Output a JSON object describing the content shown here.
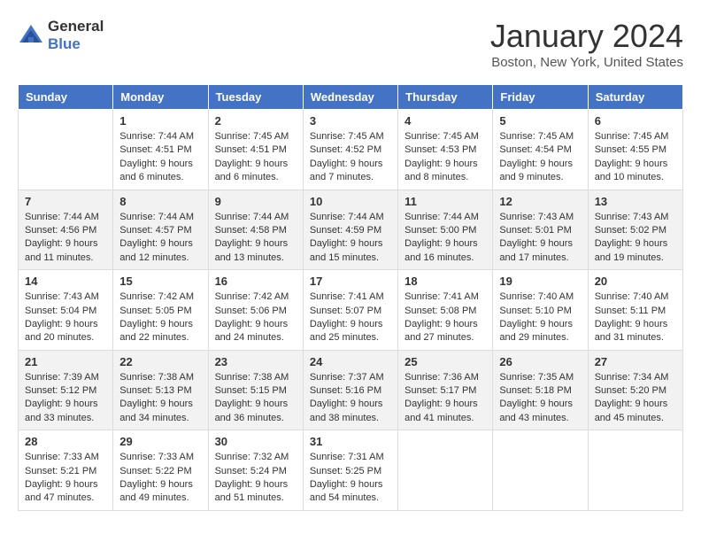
{
  "header": {
    "logo_general": "General",
    "logo_blue": "Blue",
    "month": "January 2024",
    "location": "Boston, New York, United States"
  },
  "days": [
    "Sunday",
    "Monday",
    "Tuesday",
    "Wednesday",
    "Thursday",
    "Friday",
    "Saturday"
  ],
  "weeks": [
    [
      {
        "day": "",
        "content": ""
      },
      {
        "day": "1",
        "content": "Sunrise: 7:44 AM\nSunset: 4:51 PM\nDaylight: 9 hours and 6 minutes."
      },
      {
        "day": "2",
        "content": "Sunrise: 7:45 AM\nSunset: 4:51 PM\nDaylight: 9 hours and 6 minutes."
      },
      {
        "day": "3",
        "content": "Sunrise: 7:45 AM\nSunset: 4:52 PM\nDaylight: 9 hours and 7 minutes."
      },
      {
        "day": "4",
        "content": "Sunrise: 7:45 AM\nSunset: 4:53 PM\nDaylight: 9 hours and 8 minutes."
      },
      {
        "day": "5",
        "content": "Sunrise: 7:45 AM\nSunset: 4:54 PM\nDaylight: 9 hours and 9 minutes."
      },
      {
        "day": "6",
        "content": "Sunrise: 7:45 AM\nSunset: 4:55 PM\nDaylight: 9 hours and 10 minutes."
      }
    ],
    [
      {
        "day": "7",
        "content": "Sunrise: 7:44 AM\nSunset: 4:56 PM\nDaylight: 9 hours and 11 minutes."
      },
      {
        "day": "8",
        "content": "Sunrise: 7:44 AM\nSunset: 4:57 PM\nDaylight: 9 hours and 12 minutes."
      },
      {
        "day": "9",
        "content": "Sunrise: 7:44 AM\nSunset: 4:58 PM\nDaylight: 9 hours and 13 minutes."
      },
      {
        "day": "10",
        "content": "Sunrise: 7:44 AM\nSunset: 4:59 PM\nDaylight: 9 hours and 15 minutes."
      },
      {
        "day": "11",
        "content": "Sunrise: 7:44 AM\nSunset: 5:00 PM\nDaylight: 9 hours and 16 minutes."
      },
      {
        "day": "12",
        "content": "Sunrise: 7:43 AM\nSunset: 5:01 PM\nDaylight: 9 hours and 17 minutes."
      },
      {
        "day": "13",
        "content": "Sunrise: 7:43 AM\nSunset: 5:02 PM\nDaylight: 9 hours and 19 minutes."
      }
    ],
    [
      {
        "day": "14",
        "content": "Sunrise: 7:43 AM\nSunset: 5:04 PM\nDaylight: 9 hours and 20 minutes."
      },
      {
        "day": "15",
        "content": "Sunrise: 7:42 AM\nSunset: 5:05 PM\nDaylight: 9 hours and 22 minutes."
      },
      {
        "day": "16",
        "content": "Sunrise: 7:42 AM\nSunset: 5:06 PM\nDaylight: 9 hours and 24 minutes."
      },
      {
        "day": "17",
        "content": "Sunrise: 7:41 AM\nSunset: 5:07 PM\nDaylight: 9 hours and 25 minutes."
      },
      {
        "day": "18",
        "content": "Sunrise: 7:41 AM\nSunset: 5:08 PM\nDaylight: 9 hours and 27 minutes."
      },
      {
        "day": "19",
        "content": "Sunrise: 7:40 AM\nSunset: 5:10 PM\nDaylight: 9 hours and 29 minutes."
      },
      {
        "day": "20",
        "content": "Sunrise: 7:40 AM\nSunset: 5:11 PM\nDaylight: 9 hours and 31 minutes."
      }
    ],
    [
      {
        "day": "21",
        "content": "Sunrise: 7:39 AM\nSunset: 5:12 PM\nDaylight: 9 hours and 33 minutes."
      },
      {
        "day": "22",
        "content": "Sunrise: 7:38 AM\nSunset: 5:13 PM\nDaylight: 9 hours and 34 minutes."
      },
      {
        "day": "23",
        "content": "Sunrise: 7:38 AM\nSunset: 5:15 PM\nDaylight: 9 hours and 36 minutes."
      },
      {
        "day": "24",
        "content": "Sunrise: 7:37 AM\nSunset: 5:16 PM\nDaylight: 9 hours and 38 minutes."
      },
      {
        "day": "25",
        "content": "Sunrise: 7:36 AM\nSunset: 5:17 PM\nDaylight: 9 hours and 41 minutes."
      },
      {
        "day": "26",
        "content": "Sunrise: 7:35 AM\nSunset: 5:18 PM\nDaylight: 9 hours and 43 minutes."
      },
      {
        "day": "27",
        "content": "Sunrise: 7:34 AM\nSunset: 5:20 PM\nDaylight: 9 hours and 45 minutes."
      }
    ],
    [
      {
        "day": "28",
        "content": "Sunrise: 7:33 AM\nSunset: 5:21 PM\nDaylight: 9 hours and 47 minutes."
      },
      {
        "day": "29",
        "content": "Sunrise: 7:33 AM\nSunset: 5:22 PM\nDaylight: 9 hours and 49 minutes."
      },
      {
        "day": "30",
        "content": "Sunrise: 7:32 AM\nSunset: 5:24 PM\nDaylight: 9 hours and 51 minutes."
      },
      {
        "day": "31",
        "content": "Sunrise: 7:31 AM\nSunset: 5:25 PM\nDaylight: 9 hours and 54 minutes."
      },
      {
        "day": "",
        "content": ""
      },
      {
        "day": "",
        "content": ""
      },
      {
        "day": "",
        "content": ""
      }
    ]
  ]
}
